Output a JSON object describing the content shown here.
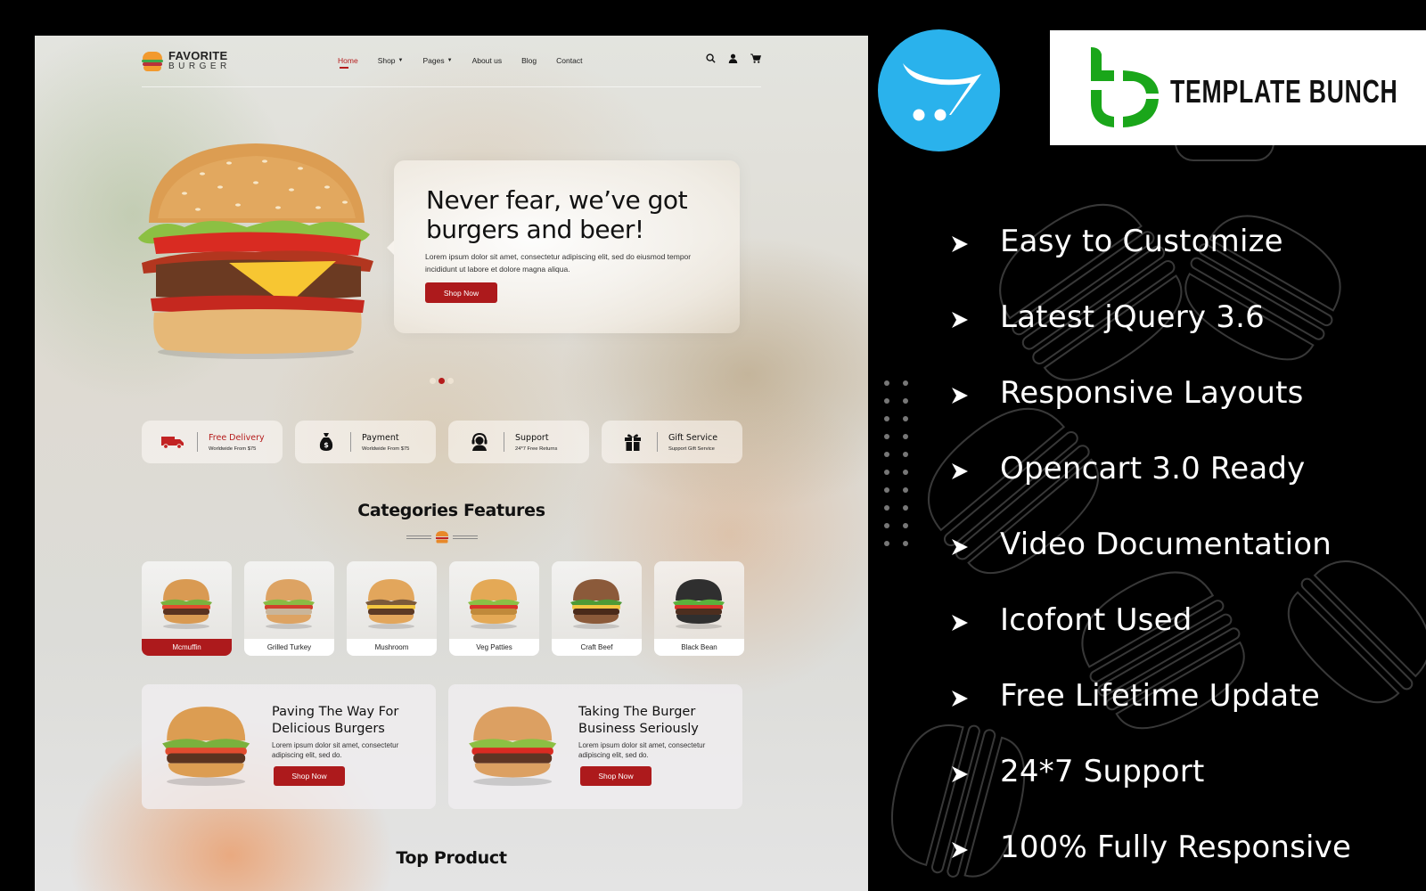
{
  "preview": {
    "logo": {
      "line1": "FAVORITE",
      "line2": "BURGER"
    },
    "nav": [
      {
        "label": "Home",
        "active": true,
        "dropdown": false
      },
      {
        "label": "Shop",
        "active": false,
        "dropdown": true
      },
      {
        "label": "Pages",
        "active": false,
        "dropdown": true
      },
      {
        "label": "About us",
        "active": false,
        "dropdown": false
      },
      {
        "label": "Blog",
        "active": false,
        "dropdown": false
      },
      {
        "label": "Contact",
        "active": false,
        "dropdown": false
      }
    ],
    "header_icons": [
      "search-icon",
      "user-icon",
      "cart-icon"
    ],
    "hero": {
      "title_line1": "Never fear, we’ve got",
      "title_line2": "burgers and beer!",
      "description": "Lorem ipsum dolor sit amet, consectetur adipiscing elit, sed do eiusmod tempor incididunt ut labore et dolore magna aliqua.",
      "button": "Shop Now",
      "slides": 3,
      "active_slide": 2
    },
    "services": [
      {
        "icon": "truck-icon",
        "title": "Free Delivery",
        "subtitle": "Worldwide From $75",
        "highlight": true
      },
      {
        "icon": "money-bag-icon",
        "title": "Payment",
        "subtitle": "Worldwide From $75",
        "highlight": false
      },
      {
        "icon": "headset-icon",
        "title": "Support",
        "subtitle": "24*7 Free Returns",
        "highlight": false
      },
      {
        "icon": "gift-icon",
        "title": "Gift Service",
        "subtitle": "Support Gift Service",
        "highlight": false
      }
    ],
    "categories": {
      "title": "Categories Features",
      "items": [
        {
          "label": "Mcmuffin",
          "active": true
        },
        {
          "label": "Grilled Turkey",
          "active": false
        },
        {
          "label": "Mushroom",
          "active": false
        },
        {
          "label": "Veg Patties",
          "active": false
        },
        {
          "label": "Craft Beef",
          "active": false
        },
        {
          "label": "Black Bean",
          "active": false
        }
      ]
    },
    "promos": [
      {
        "title": "Paving The Way For Delicious Burgers",
        "description": "Lorem ipsum dolor sit amet, consectetur adipiscing elit, sed do.",
        "button": "Shop Now"
      },
      {
        "title": "Taking The Burger Business Seriously",
        "description": "Lorem ipsum dolor sit amet, consectetur adipiscing elit, sed do.",
        "button": "Shop Now"
      }
    ],
    "top_product_title": "Top Product"
  },
  "panel": {
    "brand": "TEMPLATE BUNCH",
    "platform_logo": "opencart-logo",
    "features": [
      "Easy to Customize",
      "Latest jQuery 3.6",
      "Responsive Layouts",
      "Opencart 3.0 Ready",
      "Video Documentation",
      "Icofont Used",
      "Free Lifetime Update",
      "24*7 Support",
      "100% Fully Responsive"
    ]
  },
  "colors": {
    "accent_red": "#ad1a1c",
    "opencart_blue": "#2ab2ec",
    "brand_green": "#1aa61a",
    "panel_bg": "#000000"
  }
}
